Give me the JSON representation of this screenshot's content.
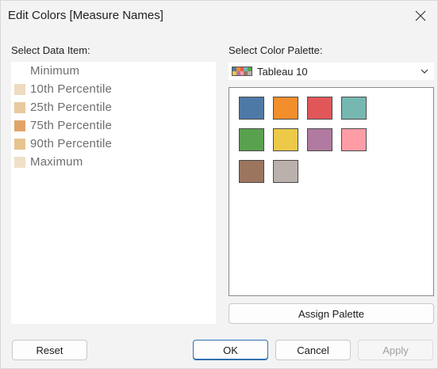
{
  "window": {
    "title": "Edit Colors [Measure Names]"
  },
  "left": {
    "heading": "Select Data Item:",
    "items": [
      {
        "label": "Minimum",
        "color": "#ffffff"
      },
      {
        "label": "10th Percentile",
        "color": "#eedbc2"
      },
      {
        "label": "25th Percentile",
        "color": "#e8c9a0"
      },
      {
        "label": "75th Percentile",
        "color": "#e0a566"
      },
      {
        "label": "90th Percentile",
        "color": "#e6c48f"
      },
      {
        "label": "Maximum",
        "color": "#f0e0c8"
      }
    ]
  },
  "right": {
    "heading": "Select Color Palette:",
    "selected_palette": "Tableau 10",
    "colors": [
      "#4e79a7",
      "#f28e2b",
      "#e15759",
      "#76b7b2",
      "#59a14f",
      "#edc948",
      "#b07aa1",
      "#ff9da7",
      "#9c755f",
      "#bab0ac"
    ],
    "assign_label": "Assign Palette"
  },
  "footer": {
    "reset_label": "Reset",
    "ok_label": "OK",
    "cancel_label": "Cancel",
    "apply_label": "Apply"
  }
}
